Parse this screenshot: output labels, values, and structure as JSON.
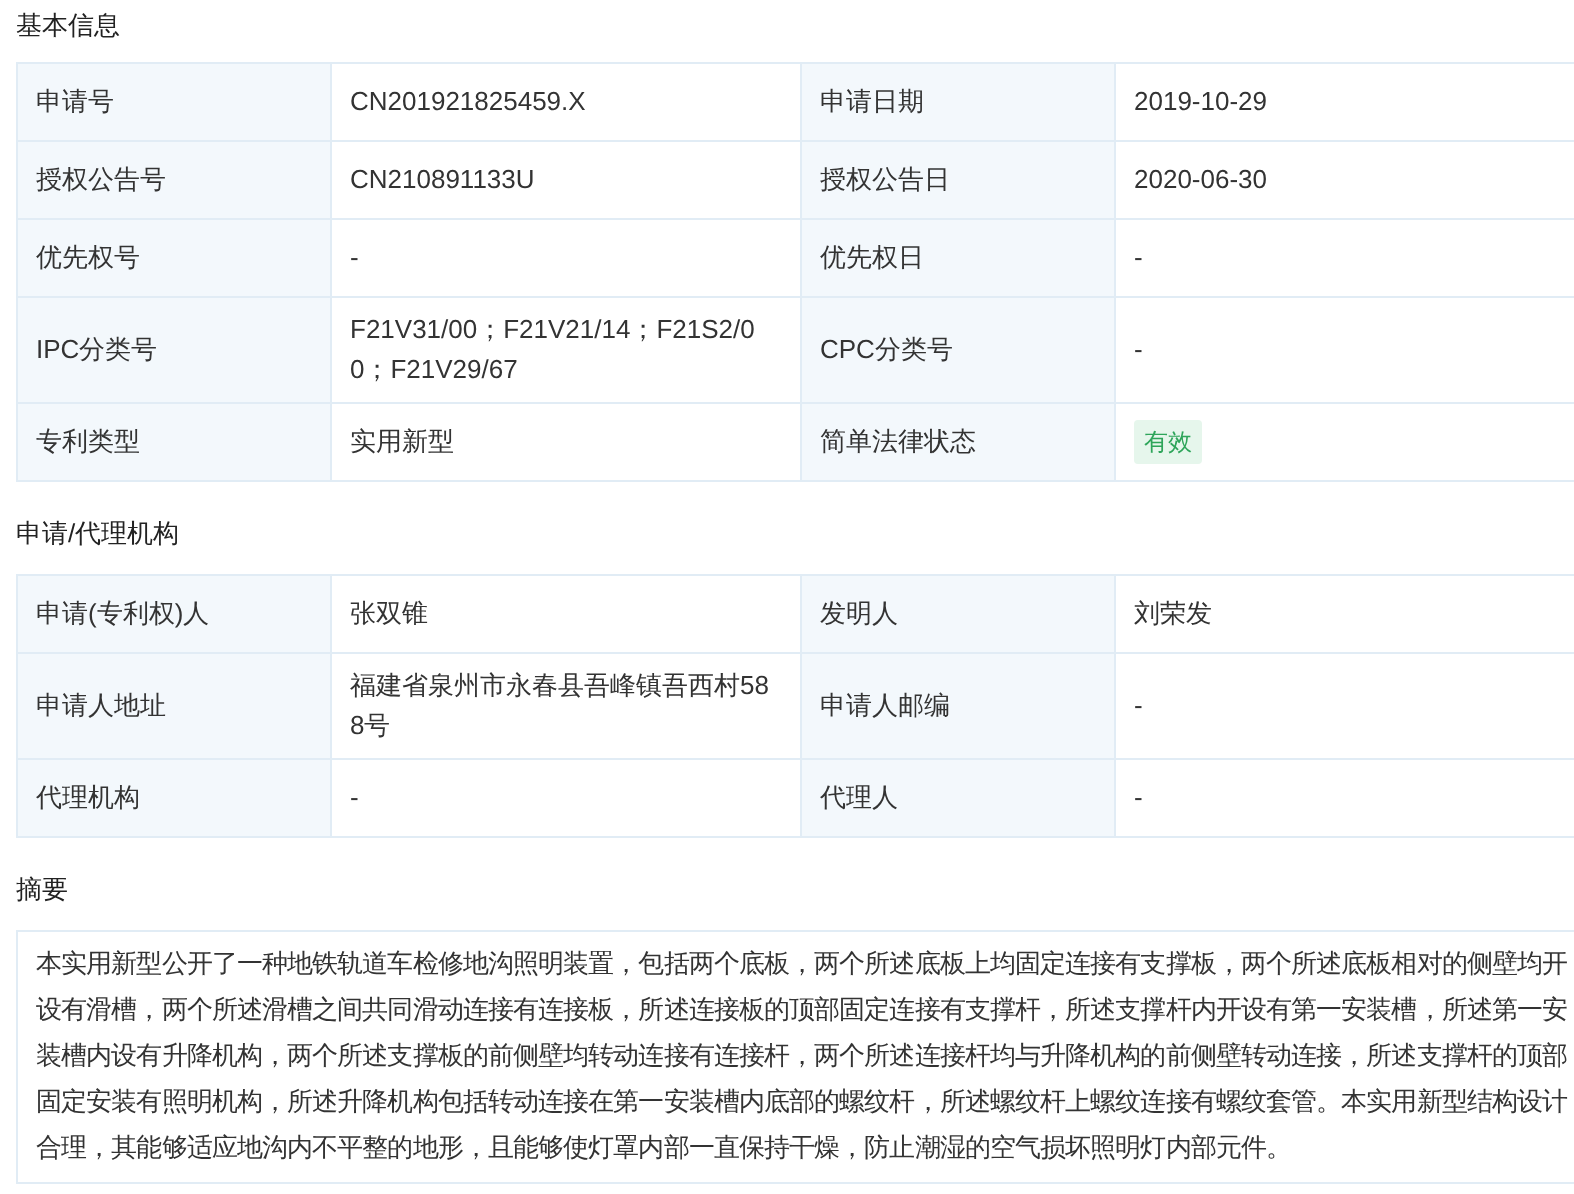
{
  "sections": [
    {
      "title": "基本信息",
      "rows": [
        [
          {
            "label": "申请号",
            "value": "CN201921825459.X"
          },
          {
            "label": "申请日期",
            "value": "2019-10-29"
          }
        ],
        [
          {
            "label": "授权公告号",
            "value": "CN210891133U"
          },
          {
            "label": "授权公告日",
            "value": "2020-06-30"
          }
        ],
        [
          {
            "label": "优先权号",
            "value": "-"
          },
          {
            "label": "优先权日",
            "value": "-"
          }
        ],
        [
          {
            "label": "IPC分类号",
            "value": "F21V31/00；F21V21/14；F21S2/00；F21V29/67"
          },
          {
            "label": "CPC分类号",
            "value": "-"
          }
        ],
        [
          {
            "label": "专利类型",
            "value": "实用新型"
          },
          {
            "label": "简单法律状态",
            "value": "有效",
            "kind": "badge"
          }
        ]
      ]
    },
    {
      "title": "申请/代理机构",
      "rows": [
        [
          {
            "label": "申请(专利权)人",
            "value": "张双锥"
          },
          {
            "label": "发明人",
            "value": "刘荣发"
          }
        ],
        [
          {
            "label": "申请人地址",
            "value": "福建省泉州市永春县吾峰镇吾西村588号"
          },
          {
            "label": "申请人邮编",
            "value": "-"
          }
        ],
        [
          {
            "label": "代理机构",
            "value": "-"
          },
          {
            "label": "代理人",
            "value": "-"
          }
        ]
      ]
    }
  ],
  "abstract": {
    "title": "摘要",
    "text": "本实用新型公开了一种地铁轨道车检修地沟照明装置，包括两个底板，两个所述底板上均固定连接有支撑板，两个所述底板相对的侧壁均开设有滑槽，两个所述滑槽之间共同滑动连接有连接板，所述连接板的顶部固定连接有支撑杆，所述支撑杆内开设有第一安装槽，所述第一安装槽内设有升降机构，两个所述支撑板的前侧壁均转动连接有连接杆，两个所述连接杆均与升降机构的前侧壁转动连接，所述支撑杆的顶部固定安装有照明机构，所述升降机构包括转动连接在第一安装槽内底部的螺纹杆，所述螺纹杆上螺纹连接有螺纹套管。本实用新型结构设计合理，其能够适应地沟内不平整的地形，且能够使灯罩内部一直保持干燥，防止潮湿的空气损坏照明灯内部元件。"
  }
}
